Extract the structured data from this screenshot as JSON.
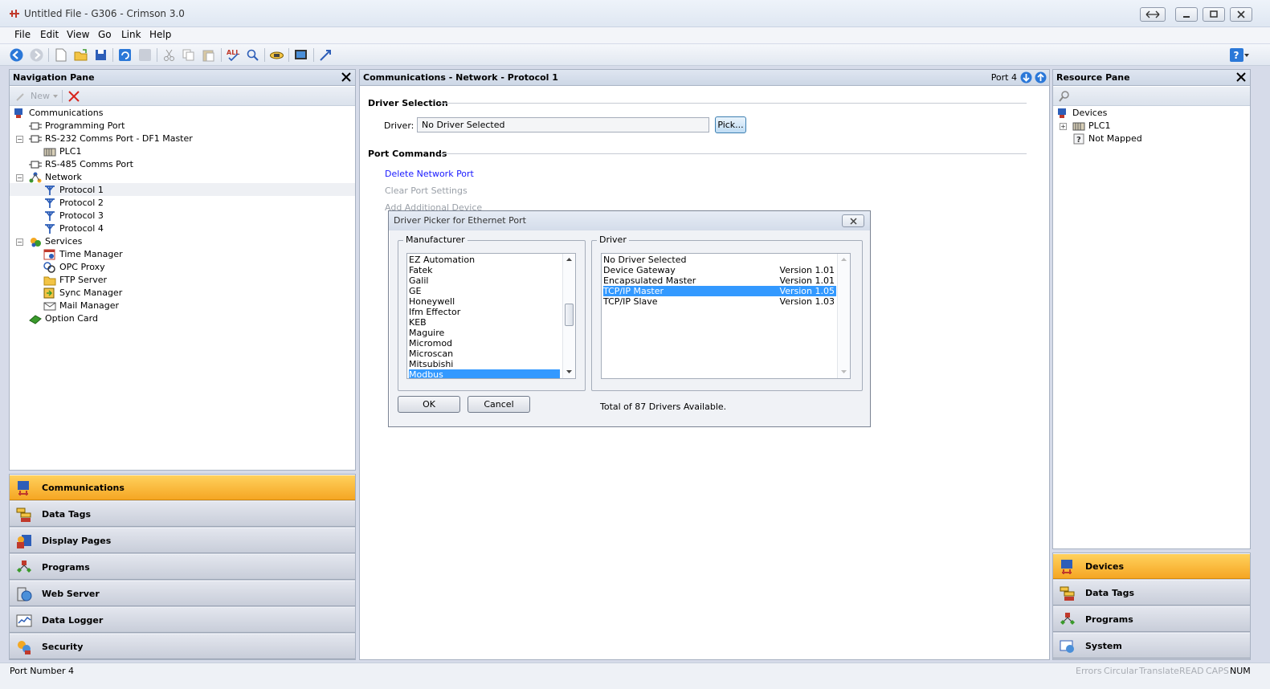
{
  "window": {
    "title": "Untitled File - G306 - Crimson 3.0"
  },
  "menu": [
    "File",
    "Edit",
    "View",
    "Go",
    "Link",
    "Help"
  ],
  "nav_pane": {
    "title": "Navigation Pane",
    "new_label": "New",
    "tree": [
      {
        "label": "Communications",
        "icon": "communications-icon"
      },
      {
        "label": "Programming Port",
        "icon": "port-icon"
      },
      {
        "label": "RS-232 Comms Port - DF1 Master",
        "icon": "port-icon"
      },
      {
        "label": "PLC1",
        "icon": "plc-icon"
      },
      {
        "label": "RS-485 Comms Port",
        "icon": "port-icon"
      },
      {
        "label": "Network",
        "icon": "network-icon"
      },
      {
        "label": "Protocol 1",
        "icon": "protocol-icon"
      },
      {
        "label": "Protocol 2",
        "icon": "protocol-icon"
      },
      {
        "label": "Protocol 3",
        "icon": "protocol-icon"
      },
      {
        "label": "Protocol 4",
        "icon": "protocol-icon"
      },
      {
        "label": "Services",
        "icon": "services-icon"
      },
      {
        "label": "Time Manager",
        "icon": "calendar-icon"
      },
      {
        "label": "OPC Proxy",
        "icon": "opc-icon"
      },
      {
        "label": "FTP Server",
        "icon": "folder-icon"
      },
      {
        "label": "Sync Manager",
        "icon": "sync-icon"
      },
      {
        "label": "Mail Manager",
        "icon": "mail-icon"
      },
      {
        "label": "Option Card",
        "icon": "card-icon"
      }
    ],
    "categories": [
      "Communications",
      "Data Tags",
      "Display Pages",
      "Programs",
      "Web Server",
      "Data Logger",
      "Security"
    ]
  },
  "main": {
    "header": "Communications - Network - Protocol 1",
    "port_label": "Port 4",
    "driver_section": "Driver Selection",
    "driver_label": "Driver:",
    "driver_value": "No Driver Selected",
    "pick_label": "Pick...",
    "commands_section": "Port Commands",
    "commands": [
      "Delete Network Port",
      "Clear Port Settings",
      "Add Additional Device"
    ]
  },
  "dialog": {
    "title": "Driver Picker for Ethernet Port",
    "manufacturer_label": "Manufacturer",
    "driver_label": "Driver",
    "manufacturers": [
      "EZ Automation",
      "Fatek",
      "Galil",
      "GE",
      "Honeywell",
      "Ifm Effector",
      "KEB",
      "Maguire",
      "Micromod",
      "Microscan",
      "Mitsubishi",
      "Modbus"
    ],
    "selected_manufacturer": "Modbus",
    "drivers": [
      {
        "name": "No Driver Selected",
        "version": ""
      },
      {
        "name": "Device Gateway",
        "version": "Version 1.01"
      },
      {
        "name": "Encapsulated Master",
        "version": "Version 1.01"
      },
      {
        "name": "TCP/IP Master",
        "version": "Version 1.05"
      },
      {
        "name": "TCP/IP Slave",
        "version": "Version 1.03"
      }
    ],
    "selected_driver": "TCP/IP Master",
    "ok_label": "OK",
    "cancel_label": "Cancel",
    "total_text": "Total of 87 Drivers Available."
  },
  "resource_pane": {
    "title": "Resource Pane",
    "tree": [
      {
        "label": "Devices"
      },
      {
        "label": "PLC1"
      },
      {
        "label": "Not Mapped"
      }
    ],
    "categories": [
      "Devices",
      "Data Tags",
      "Programs",
      "System"
    ]
  },
  "status": {
    "text": "Port Number 4",
    "flags": [
      "Errors",
      "Circular",
      "Translate",
      "READ",
      "CAPS",
      "NUM"
    ]
  },
  "colors": {
    "accent": "#f5a623",
    "selection": "#3399ff",
    "link": "#1a1aff"
  }
}
